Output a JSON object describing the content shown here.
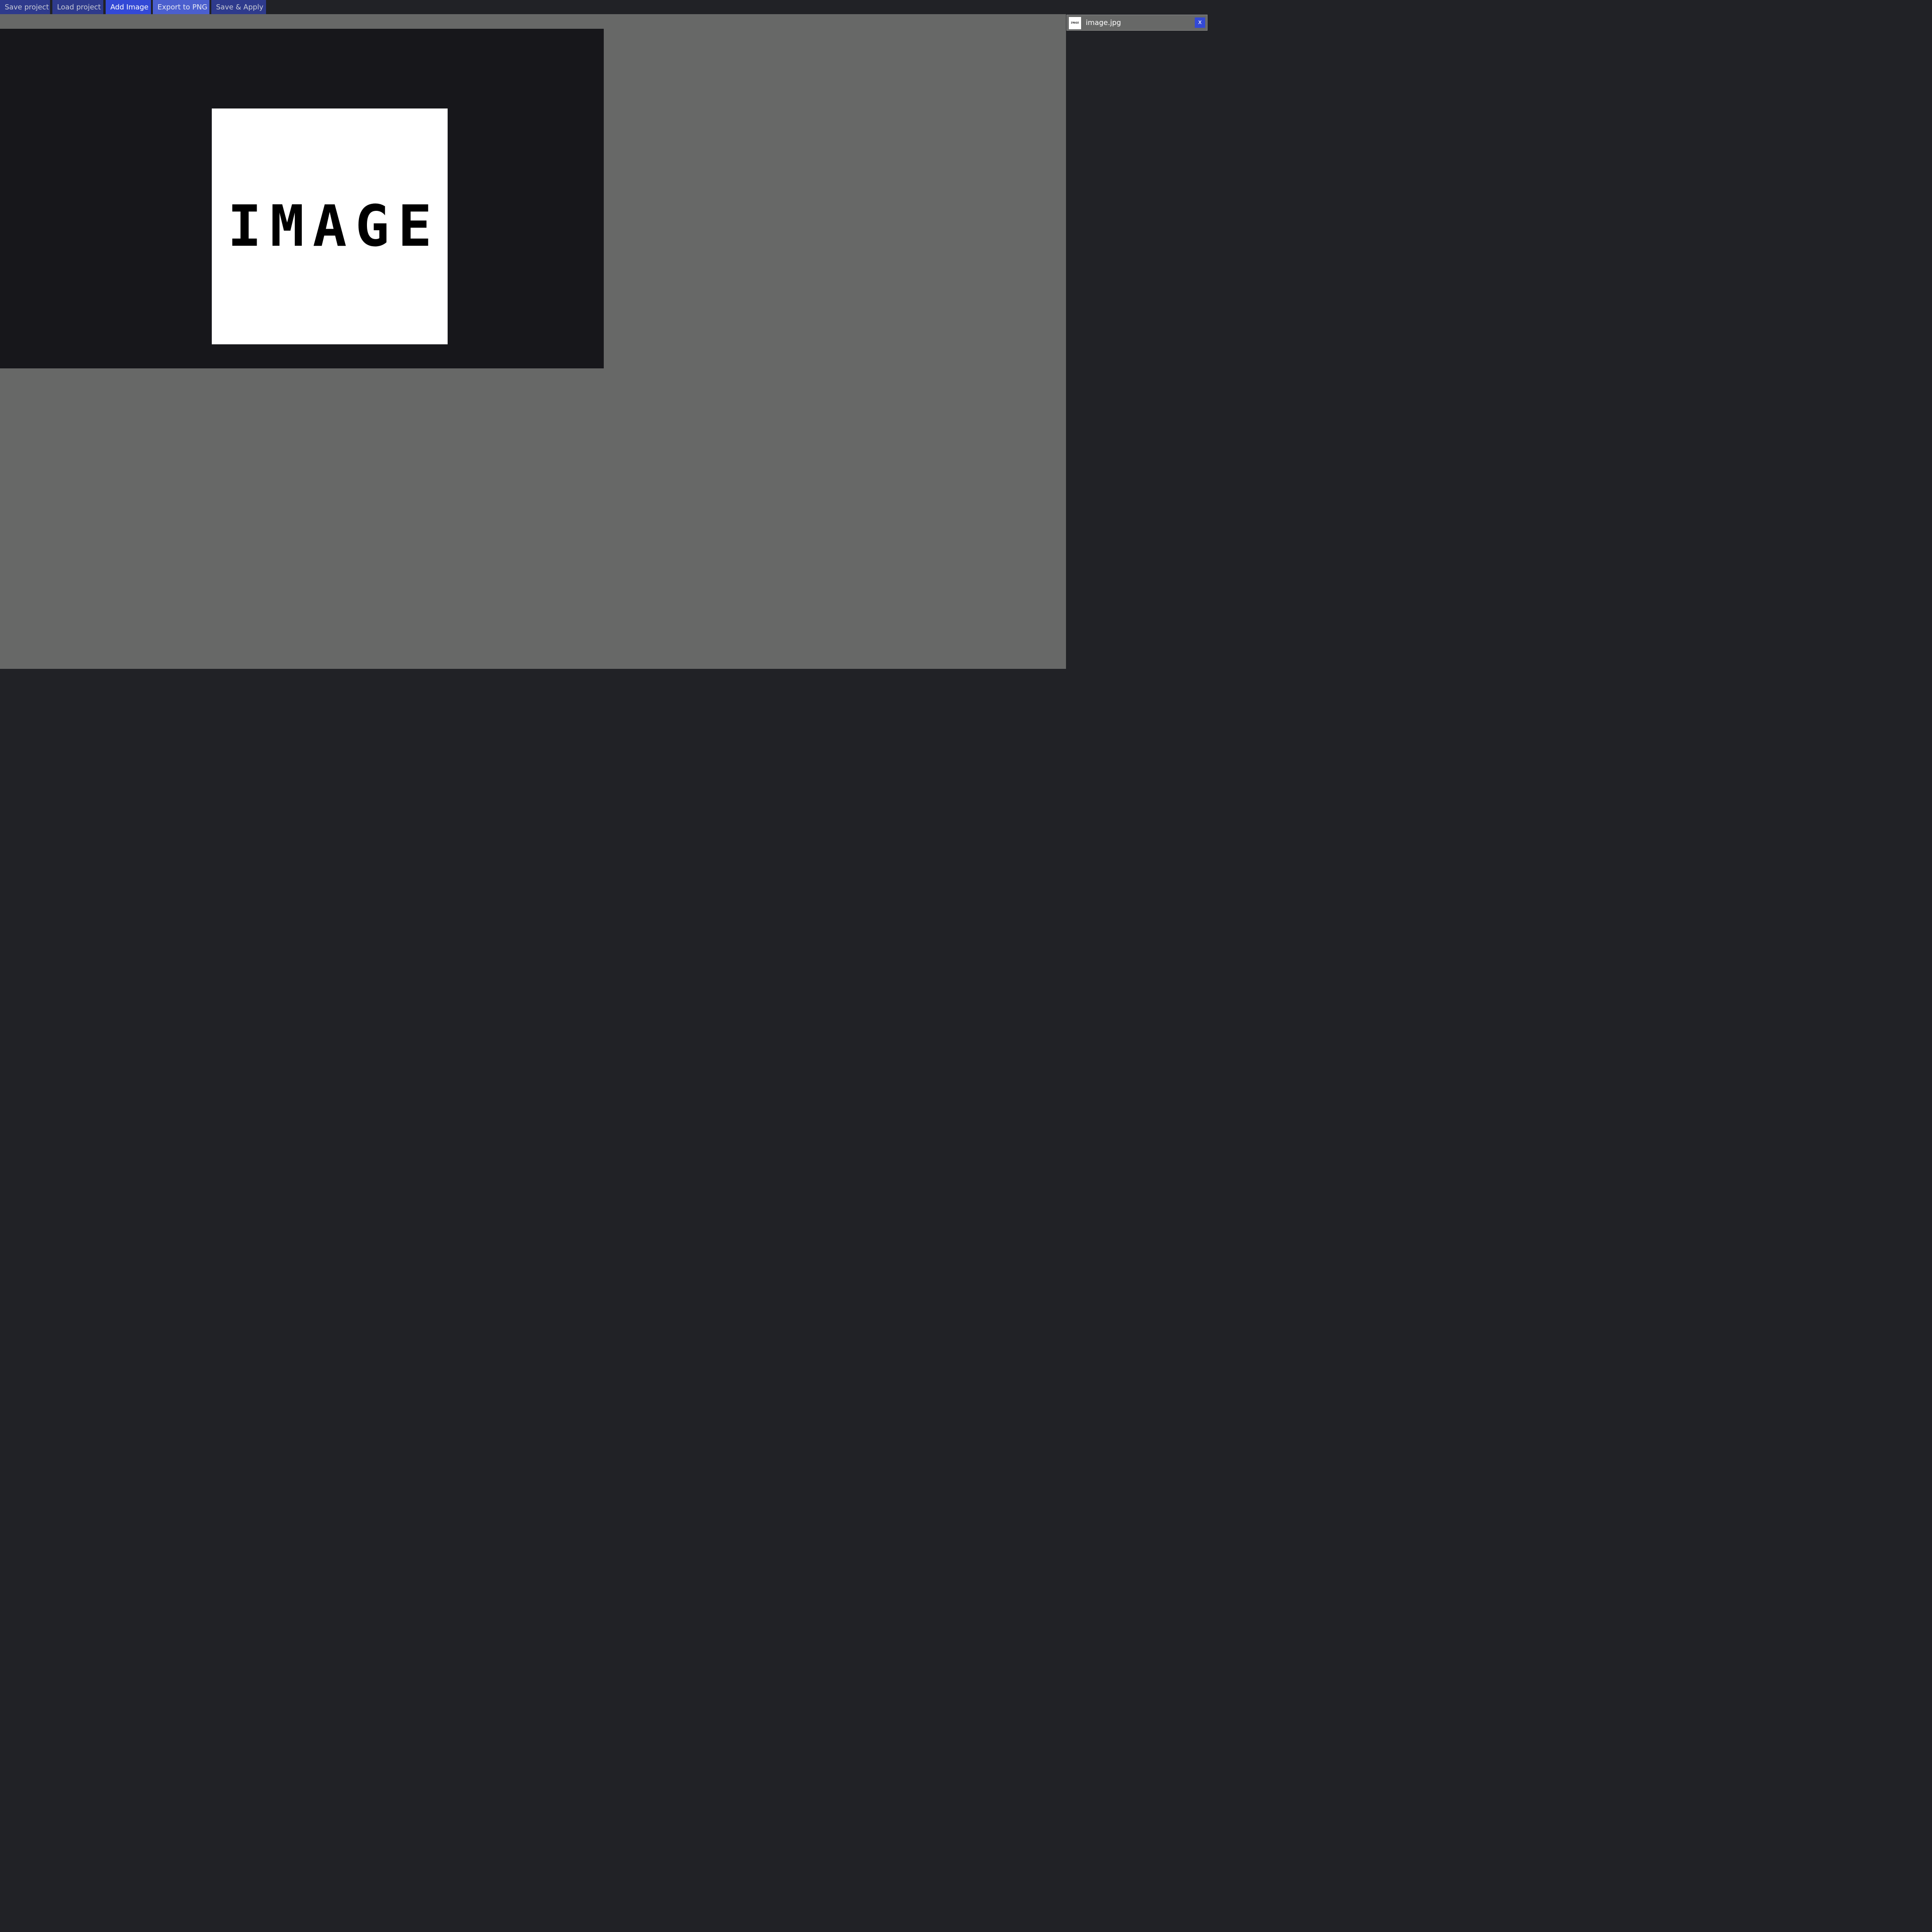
{
  "toolbar": {
    "save_project": "Save project",
    "load_project": "Load project",
    "add_image": "Add Image",
    "export_png": "Export to PNG",
    "save_apply": "Save & Apply"
  },
  "canvas": {
    "image_text": "IMAGE"
  },
  "layers": {
    "items": [
      {
        "name": "image.jpg",
        "thumb_text": "IMAGE",
        "close_label": "x"
      }
    ]
  },
  "colors": {
    "accent": "#3349d6",
    "button": "#2e3a8c",
    "workspace": "#676867",
    "canvas": "#17171b",
    "background": "#212226"
  }
}
